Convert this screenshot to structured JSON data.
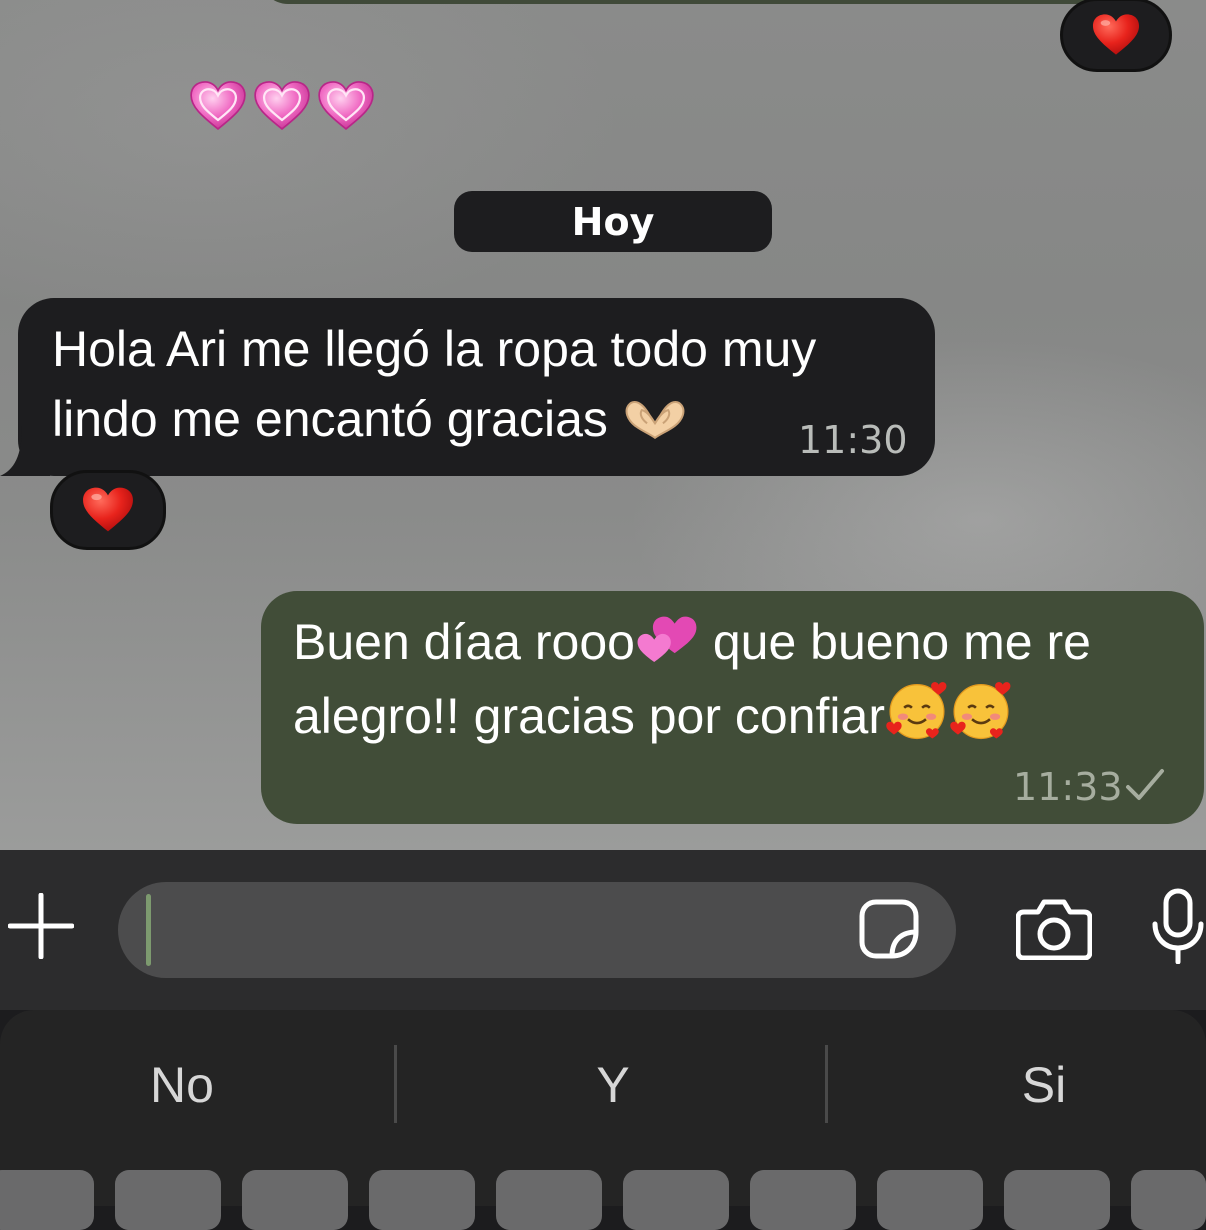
{
  "date_separator": "Hoy",
  "messages": [
    {
      "direction": "incoming",
      "text_line1": "Hola Ari me llegó la ropa todo muy",
      "text_line2": "lindo me encantó gracias",
      "time": "11:30",
      "reaction": "red-heart"
    },
    {
      "direction": "outgoing",
      "text_line1_a": "Buen díaa rooo",
      "text_line1_b": "que bueno me re",
      "text_line2": "alegro!! gracias por confiar",
      "time": "11:33",
      "status": "sent-check"
    }
  ],
  "previous_reaction": "red-heart",
  "floating_emojis": [
    "pink-heart",
    "pink-heart",
    "pink-heart"
  ],
  "composer": {
    "input_value": "",
    "icons": [
      "plus-icon",
      "sticker-icon",
      "camera-icon",
      "microphone-icon"
    ]
  },
  "keyboard": {
    "suggestions": [
      "No",
      "Y",
      "Si"
    ]
  },
  "colors": {
    "incoming_bubble": "#1d1d1f",
    "outgoing_bubble": "#414d38",
    "accent": "#7d9a6f"
  }
}
